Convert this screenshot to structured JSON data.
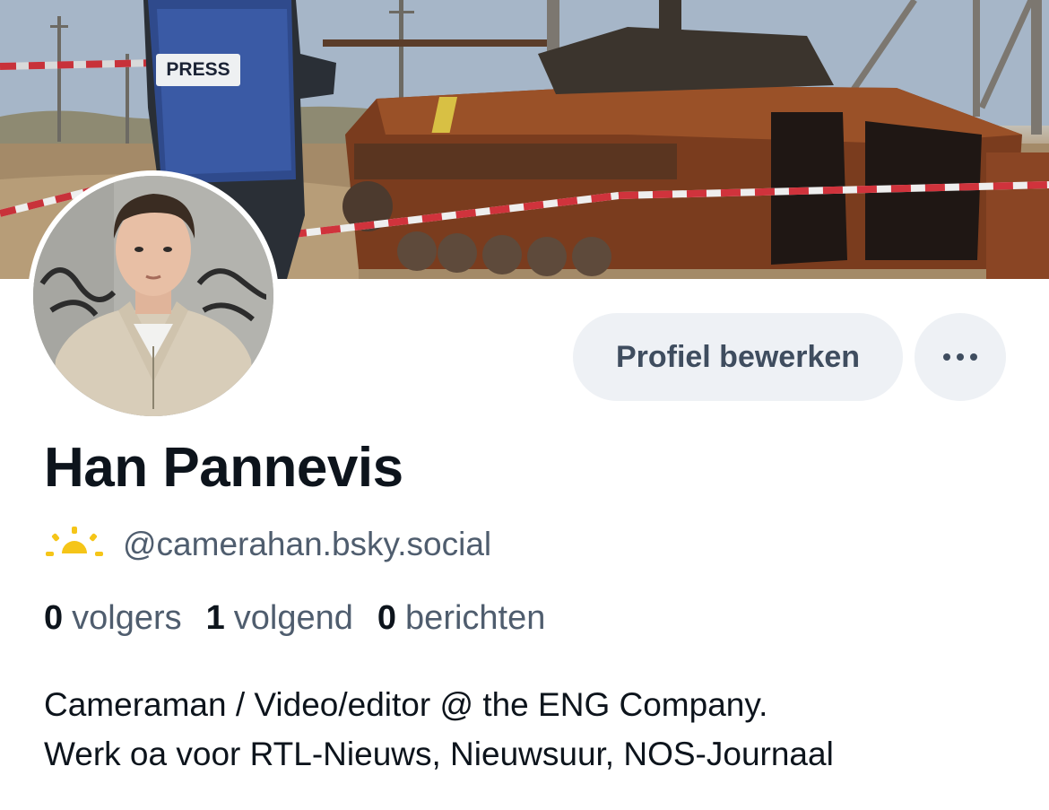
{
  "profile": {
    "display_name": "Han Pannevis",
    "handle": "@camerahan.bsky.social",
    "bio_line1": "Cameraman / Video/editor @ the ENG Company.",
    "bio_line2": "Werk oa voor RTL-Nieuws, Nieuwsuur, NOS-Journaal"
  },
  "stats": {
    "followers_count": "0",
    "followers_label": "volgers",
    "following_count": "1",
    "following_label": "volgend",
    "posts_count": "0",
    "posts_label": "berichten"
  },
  "actions": {
    "edit_profile_label": "Profiel bewerken",
    "more_icon": "ellipsis-icon"
  },
  "banner": {
    "press_vest_text": "PRESS"
  },
  "icons": {
    "handle_badge": "sunrise-icon"
  },
  "colors": {
    "button_bg": "#eef1f5",
    "button_text": "#3f4d5f",
    "secondary_text": "#4f5d6e",
    "primary_text": "#0d141c",
    "sun_yellow": "#f5c518"
  }
}
